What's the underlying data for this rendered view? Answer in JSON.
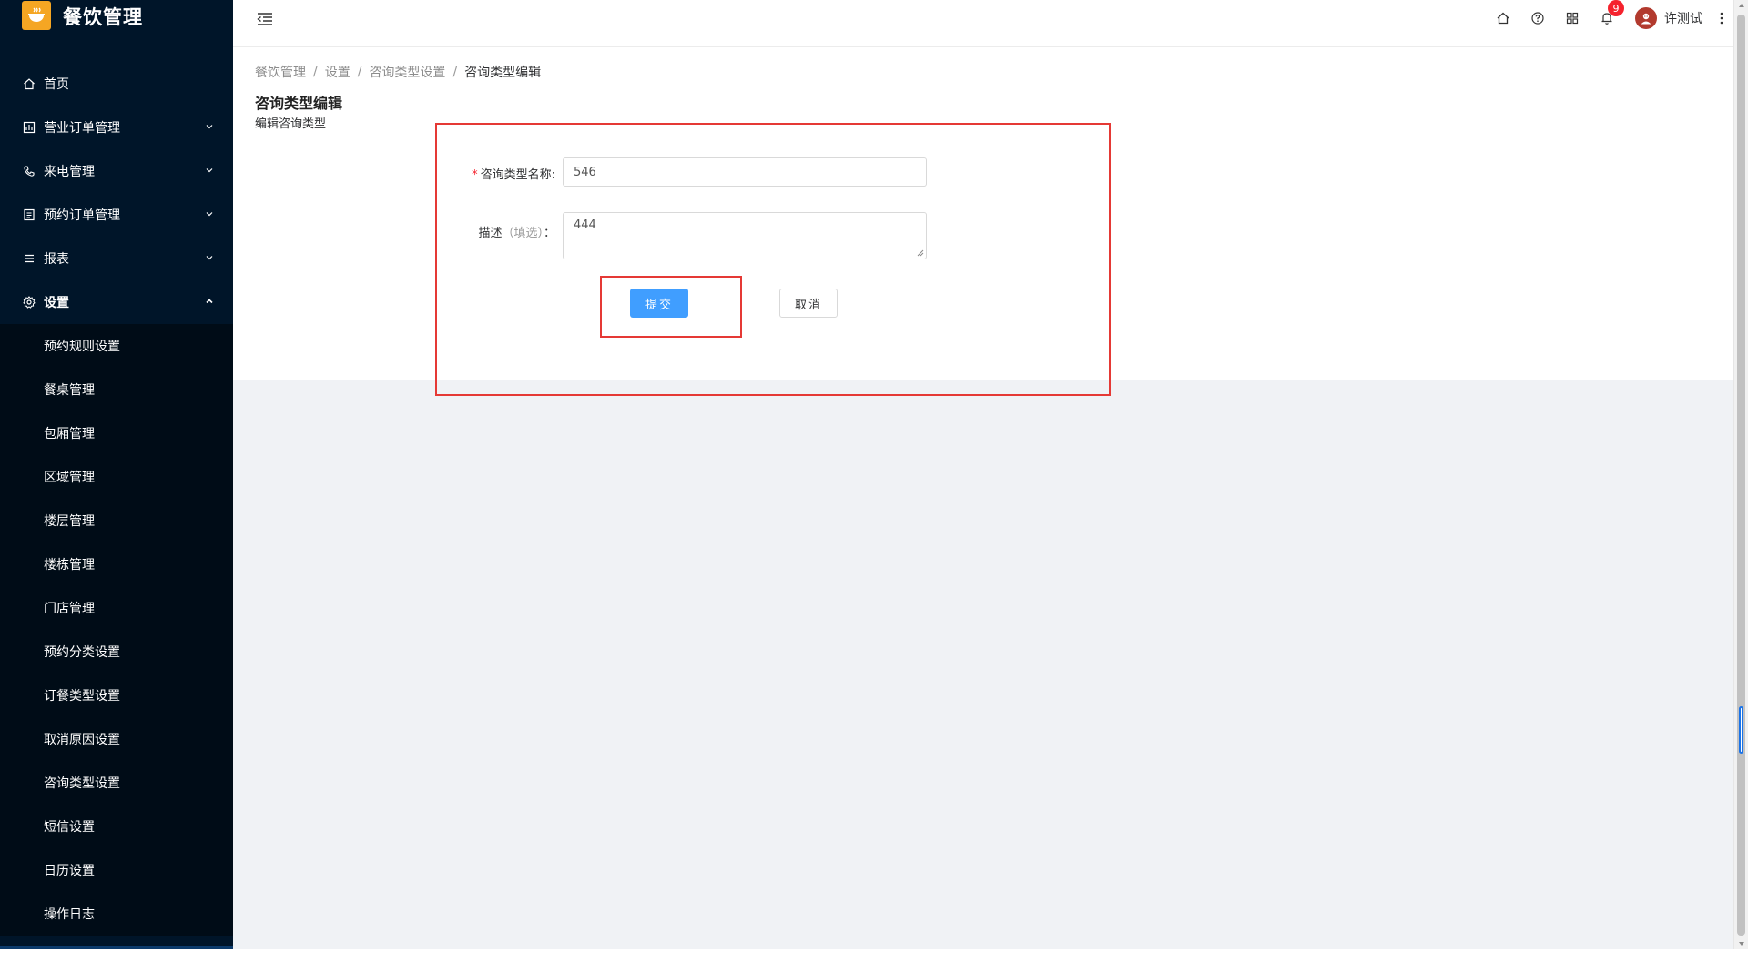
{
  "app": {
    "title": "餐饮管理"
  },
  "sidebar": {
    "items": [
      {
        "label": "首页",
        "icon": "home-icon"
      },
      {
        "label": "营业订单管理",
        "icon": "order-icon"
      },
      {
        "label": "来电管理",
        "icon": "phone-icon"
      },
      {
        "label": "预约订单管理",
        "icon": "booking-icon"
      },
      {
        "label": "报表",
        "icon": "report-icon"
      },
      {
        "label": "设置",
        "icon": "settings-icon"
      }
    ],
    "settings_sub": [
      "预约规则设置",
      "餐桌管理",
      "包厢管理",
      "区域管理",
      "楼层管理",
      "楼栋管理",
      "门店管理",
      "预约分类设置",
      "订餐类型设置",
      "取消原因设置",
      "咨询类型设置",
      "短信设置",
      "日历设置",
      "操作日志"
    ]
  },
  "header": {
    "notification_count": "9",
    "username": "许测试"
  },
  "breadcrumb": [
    "餐饮管理",
    "设置",
    "咨询类型设置",
    "咨询类型编辑"
  ],
  "page": {
    "title": "咨询类型编辑",
    "subtitle": "编辑咨询类型"
  },
  "form": {
    "name_label": "咨询类型名称:",
    "name_required_mark": "*",
    "name_value": "546",
    "desc_label": "描述",
    "desc_optional": "（填选）",
    "desc_colon": "：",
    "desc_value": "444",
    "submit_label": "提交",
    "cancel_label": "取消"
  },
  "colors": {
    "sidebar_bg": "#001529",
    "primary": "#409eff",
    "highlight": "#e53935",
    "badge": "#f5222d"
  }
}
